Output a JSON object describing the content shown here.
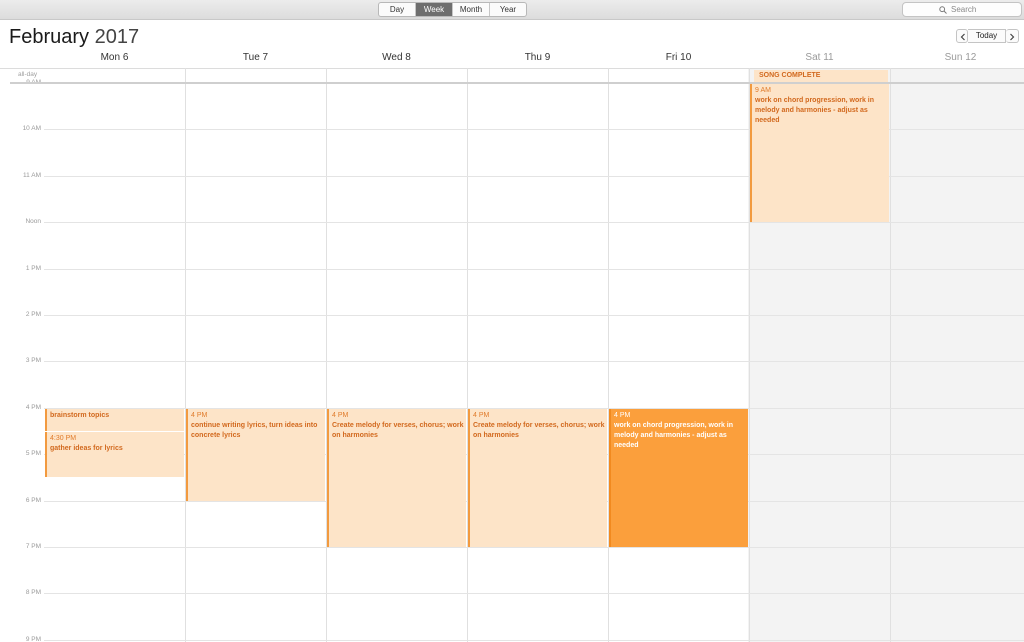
{
  "toolbar": {
    "view_tabs": [
      {
        "label": "Day",
        "active": false
      },
      {
        "label": "Week",
        "active": true
      },
      {
        "label": "Month",
        "active": false
      },
      {
        "label": "Year",
        "active": false
      }
    ],
    "search_placeholder": "Search",
    "search_icon": "search-icon"
  },
  "header": {
    "month": "February",
    "year": "2017",
    "today_label": "Today",
    "prev_icon": "chevron-left-icon",
    "next_icon": "chevron-right-icon"
  },
  "days": [
    {
      "label": "Mon 6",
      "weekend": false
    },
    {
      "label": "Tue 7",
      "weekend": false
    },
    {
      "label": "Wed 8",
      "weekend": false
    },
    {
      "label": "Thu 9",
      "weekend": false
    },
    {
      "label": "Fri 10",
      "weekend": false
    },
    {
      "label": "Sat 11",
      "weekend": true
    },
    {
      "label": "Sun 12",
      "weekend": true
    }
  ],
  "allday_label": "all-day",
  "hours": [
    "9 AM",
    "10 AM",
    "11 AM",
    "Noon",
    "1 PM",
    "2 PM",
    "3 PM",
    "4 PM",
    "5 PM",
    "6 PM",
    "7 PM",
    "8 PM",
    "9 PM"
  ],
  "allday_events": [
    {
      "day": 5,
      "title": "SONG COMPLETE"
    }
  ],
  "events": [
    {
      "day": 0,
      "start": 16,
      "end": 16.5,
      "time": "",
      "title": "brainstorm topics",
      "strong": false
    },
    {
      "day": 0,
      "start": 16.5,
      "end": 17.5,
      "time": "4:30 PM",
      "title": "gather ideas for lyrics",
      "strong": false
    },
    {
      "day": 1,
      "start": 16,
      "end": 18,
      "time": "4 PM",
      "title": "continue writing lyrics, turn ideas into concrete lyrics",
      "strong": false
    },
    {
      "day": 2,
      "start": 16,
      "end": 19,
      "time": "4 PM",
      "title": "Create melody for verses, chorus; work on harmonies",
      "strong": false
    },
    {
      "day": 3,
      "start": 16,
      "end": 19,
      "time": "4 PM",
      "title": "Create melody for verses, chorus; work on harmonies",
      "strong": false
    },
    {
      "day": 4,
      "start": 16,
      "end": 19,
      "time": "4 PM",
      "title": "work on chord progression, work in melody and harmonies - adjust as needed",
      "strong": true
    },
    {
      "day": 5,
      "start": 9,
      "end": 12,
      "time": "9 AM",
      "title": "work on chord progression, work in melody and harmonies - adjust as needed",
      "strong": false
    }
  ],
  "colors": {
    "event_fill": "#fde4c8",
    "event_accent": "#f29a3f",
    "event_text": "#d2691e",
    "event_selected_fill": "#fb9f3c",
    "weekend_bg": "#f3f3f3"
  }
}
